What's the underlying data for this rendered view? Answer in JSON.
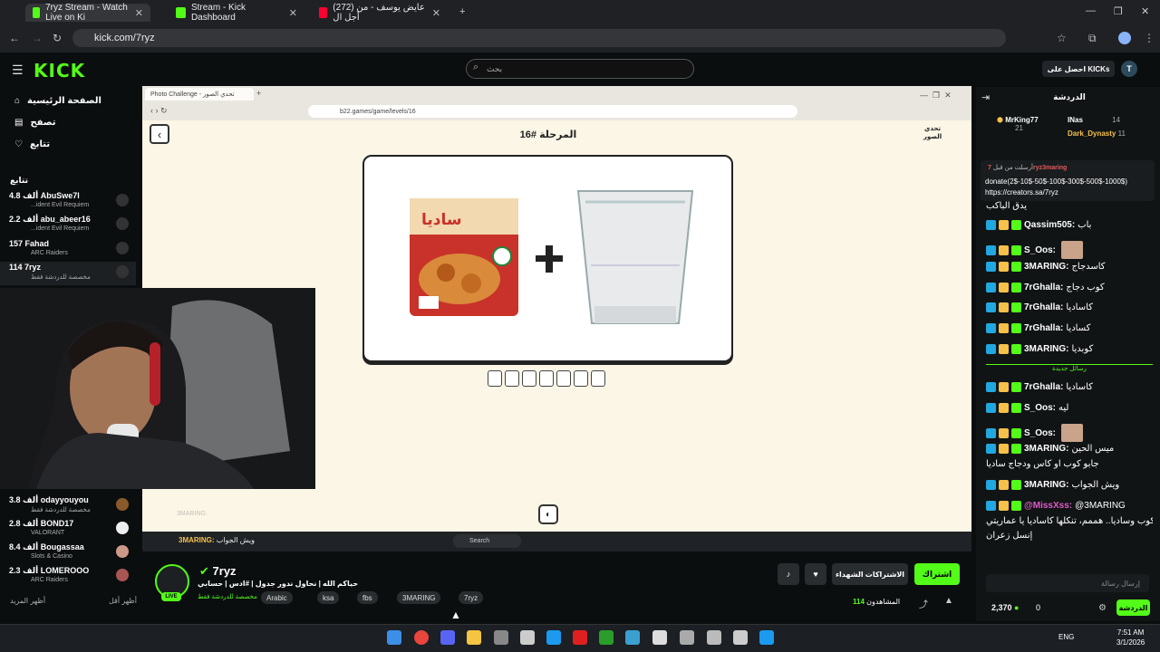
{
  "browser": {
    "tabs": [
      {
        "title": "7ryz Stream - Watch Live on Ki"
      },
      {
        "title": "Stream - Kick Dashboard"
      },
      {
        "title": "(272) عايض يوسف - من أجل ال"
      }
    ],
    "url": "kick.com/7ryz"
  },
  "kick": {
    "logo": "KICK",
    "search_placeholder": "بحث",
    "kicks_button": "احصل على KICKs",
    "avatar": "T"
  },
  "sidebar": {
    "nav": [
      {
        "label": "الصفحة الرئيسية",
        "icon": "home-icon"
      },
      {
        "label": "تصفح",
        "icon": "browse-icon"
      },
      {
        "label": "تتابع",
        "icon": "heart-icon"
      }
    ],
    "section": "تتابع",
    "channels": [
      {
        "name": "AbuSwe7l",
        "count": "4.8 ألف",
        "sub": "...ident Evil Requiem"
      },
      {
        "name": "abu_abeer16",
        "count": "2.2 ألف",
        "sub": "...ident Evil Requiem"
      },
      {
        "name": "Fahad",
        "count": "157",
        "sub": "ARC Raiders"
      },
      {
        "name": "7ryz",
        "count": "114",
        "sub": "مخصصة للدردشة فقط"
      }
    ],
    "channels2": [
      {
        "name": "odayyouyou",
        "count": "3.8 ألف",
        "sub": "مخصصة للدردشة فقط"
      },
      {
        "name": "BOND17",
        "count": "2.8 ألف",
        "sub": "VALORANT"
      },
      {
        "name": "Bougassaa",
        "count": "8.4 ألف",
        "sub": "Slots & Casino"
      },
      {
        "name": "LOMEROOO",
        "count": "2.3 ألف",
        "sub": "ARC Raiders"
      }
    ],
    "show_more": "أظهر المزيد",
    "show_less": "أظهر أقل"
  },
  "game": {
    "tab": "Photo Challenge - تحدي الصور",
    "url": "b22.games/game/levels/16",
    "level": "المرحلة #16",
    "logo": "تحدي الصور",
    "slots": 7,
    "sadia_label": "ساديا",
    "overlay_text": "ويش الجواب",
    "overlay_user": "3MARING:"
  },
  "stream": {
    "username": "7ryz",
    "title": "حياكم الله | نحاول ندور جدول | #ادس | حسابي",
    "category": "مخصصة للدردشة فقط",
    "tags": [
      "Arabic",
      "ksa",
      "fbs",
      "3MARING",
      "7ryz"
    ],
    "live": "LIVE",
    "viewers_label": "المشاهدون",
    "viewers": "114",
    "subscribe": "اشتراك",
    "gift": "الاشتراكات الشهداء"
  },
  "chat": {
    "title": "الدردشة",
    "top": [
      {
        "name": "MrKing77",
        "score": "21"
      },
      {
        "name": "INas",
        "score": "14"
      },
      {
        "name": "Dark_Dynasty",
        "score": "11"
      }
    ],
    "pinned_user": "7ryz3maring",
    "pinned_label": "أرسلت من قبل",
    "pinned_text": "donate(2$-10$-50$-100$-300$-500$-1000$) https://creators.sa/7ryz",
    "lines": [
      {
        "user": "",
        "text": "يدق الباكب"
      },
      {
        "user": "Qassim505:",
        "text": "باب"
      },
      {
        "user": "S_Oos:",
        "text": ""
      },
      {
        "user": "3MARING:",
        "text": "كاسدجاج"
      },
      {
        "user": "7rGhalla:",
        "text": "كوب دجاج"
      },
      {
        "user": "7rGhalla:",
        "text": "كاساديا"
      },
      {
        "user": "7rGhalla:",
        "text": "كساديا"
      },
      {
        "user": "3MARING:",
        "text": "كوبديا"
      },
      {
        "user": "",
        "text": "رسائل جديدة"
      },
      {
        "user": "7rGhalla:",
        "text": "كاساديا"
      },
      {
        "user": "S_Oos:",
        "text": "ليه"
      },
      {
        "user": "S_Oos:",
        "text": ""
      },
      {
        "user": "3MARING:",
        "text": "ميس الحين"
      },
      {
        "user": "",
        "text": "جابو كوب او كاس ودجاج ساديا"
      },
      {
        "user": "3MARING:",
        "text": "ويش الجواب"
      },
      {
        "user": "@MissXss:",
        "text": "@3MARING"
      },
      {
        "user": "",
        "text": "كوب وساديا.. هممم، تنكلها كاساديا يا عماريتي"
      },
      {
        "user": "",
        "text": "إنسل زعران"
      }
    ],
    "input_placeholder": "إرسال رسالة",
    "points": "2,370",
    "zero": "0",
    "send": "الدردشة"
  },
  "taskbar": {
    "search": "Search",
    "lang": "ENG",
    "time": "7:51 AM",
    "date": "3/1/2026"
  },
  "colors": {
    "kick_green": "#53fc18",
    "bg": "#0b0e0f",
    "game_bg": "#fcf6e6"
  }
}
